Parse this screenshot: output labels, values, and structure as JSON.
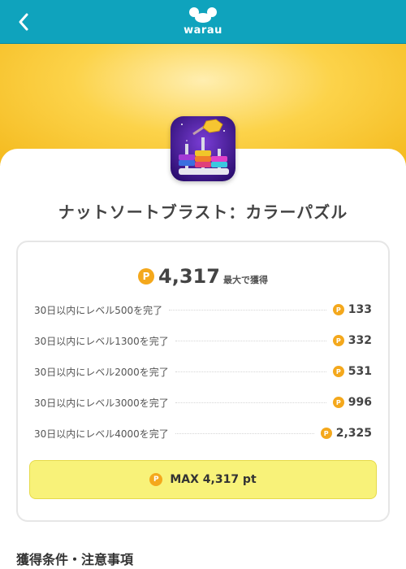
{
  "header": {
    "back_icon": "chevron-left-icon",
    "logo_text": "warau",
    "brand_color": "#0fa3bd"
  },
  "app": {
    "title": "ナットソートブラスト：カラーパズル",
    "icon": "nut-sort-app-icon"
  },
  "reward": {
    "total": "4,317",
    "total_suffix": "最大で獲得",
    "coin_symbol": "P",
    "tiers": [
      {
        "label": "30日以内にレベル500を完了",
        "points": "133"
      },
      {
        "label": "30日以内にレベル1300を完了",
        "points": "332"
      },
      {
        "label": "30日以内にレベル2000を完了",
        "points": "531"
      },
      {
        "label": "30日以内にレベル3000を完了",
        "points": "996"
      },
      {
        "label": "30日以内にレベル4000を完了",
        "points": "2,325"
      }
    ],
    "max_label": "MAX 4,317 pt"
  },
  "section": {
    "title": "獲得条件・注意事項"
  },
  "colors": {
    "coin": "#f4a81c",
    "max_button": "#f8f279",
    "hero": "#fcd34a"
  }
}
